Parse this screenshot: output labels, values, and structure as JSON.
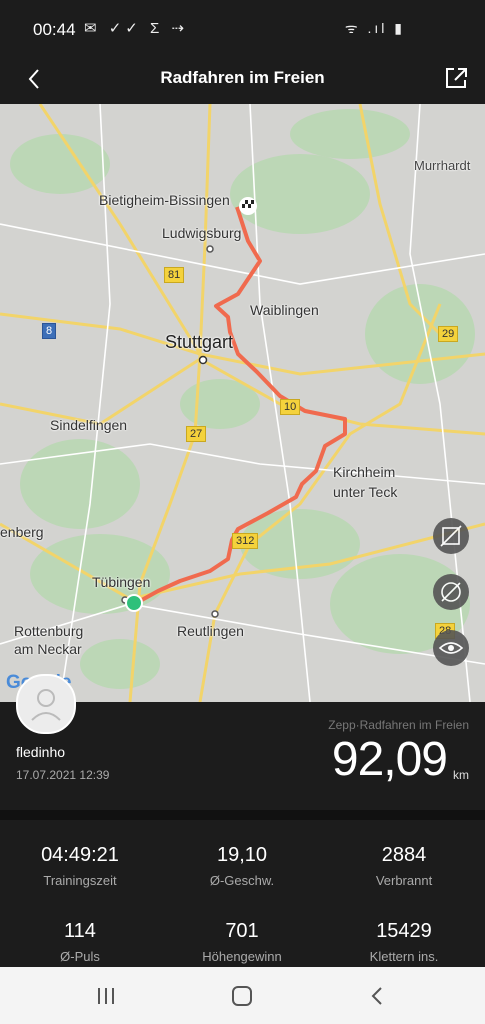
{
  "status": {
    "time": "00:44",
    "left_icons": "✉ ✓✓ Σ ⇢",
    "right_icons": "ᯤ .ıl ▮"
  },
  "appbar": {
    "title": "Radfahren im Freien"
  },
  "map": {
    "labels": {
      "murrhardt": "Murrhardt",
      "bietigheim": "Bietigheim-Bissingen",
      "ludwigsburg": "Ludwigsburg",
      "waiblingen": "Waiblingen",
      "stuttgart": "Stuttgart",
      "sindelfingen": "Sindelfingen",
      "kirchheim_1": "Kirchheim",
      "kirchheim_2": "unter Teck",
      "renberg": "enberg",
      "tuebingen": "Tübingen",
      "rottenburg_1": "Rottenburg",
      "rottenburg_2": "am Neckar",
      "reutlingen": "Reutlingen"
    },
    "roads": {
      "r81": "81",
      "r8": "8",
      "r29": "29",
      "r10": "10",
      "r27": "27",
      "r312": "312",
      "r28": "28"
    },
    "google": "Google",
    "route_color": "#f06a4e"
  },
  "profile": {
    "username": "fledinho",
    "date": "17.07.2021 12:39",
    "sport": "Zepp·Radfahren im Freien",
    "distance": "92,09",
    "unit": "km"
  },
  "stats": [
    {
      "value": "04:49:21",
      "label": "Trainingszeit"
    },
    {
      "value": "19,10",
      "label": "Ø-Geschw."
    },
    {
      "value": "2884",
      "label": "Verbrannt"
    },
    {
      "value": "114",
      "label": "Ø-Puls"
    },
    {
      "value": "701",
      "label": "Höhengewinn"
    },
    {
      "value": "15429",
      "label": "Klettern ins."
    }
  ]
}
